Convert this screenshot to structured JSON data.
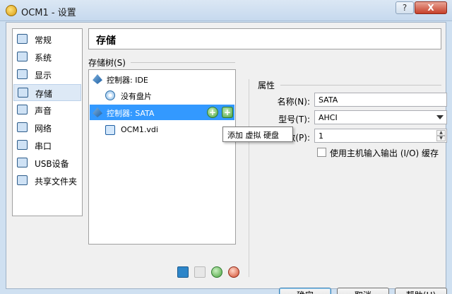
{
  "window": {
    "title": "OCM1 - 设置",
    "help_glyph": "?",
    "close_glyph": "X"
  },
  "sidebar": {
    "items": [
      {
        "label": "常规",
        "icon": "monitor-icon"
      },
      {
        "label": "系统",
        "icon": "chip-icon"
      },
      {
        "label": "显示",
        "icon": "display-icon"
      },
      {
        "label": "存储",
        "icon": "storage-icon",
        "selected": true
      },
      {
        "label": "声音",
        "icon": "speaker-icon"
      },
      {
        "label": "网络",
        "icon": "network-icon"
      },
      {
        "label": "串口",
        "icon": "serial-port-icon"
      },
      {
        "label": "USB设备",
        "icon": "usb-icon"
      },
      {
        "label": "共享文件夹",
        "icon": "folder-icon"
      }
    ]
  },
  "page_title": "存储",
  "storage_tree": {
    "label": "存储树(S)",
    "rows": [
      {
        "text": "控制器: IDE",
        "type": "controller"
      },
      {
        "text": "没有盘片",
        "type": "disc"
      },
      {
        "text": "控制器: SATA",
        "type": "controller",
        "selected": true
      },
      {
        "text": "OCM1.vdi",
        "type": "vdi"
      }
    ],
    "tooltip": "添加 虚拟 硬盘"
  },
  "properties": {
    "heading": "属性",
    "name_label": "名称(N):",
    "name_value": "SATA",
    "type_label": "型号(T):",
    "type_value": "AHCI",
    "port_label": "端口数(P):",
    "port_value": "1",
    "spin_up": "▲",
    "spin_down": "▼",
    "hostio_label": "使用主机输入输出 (I/O) 缓存",
    "hostio_checked": false
  },
  "buttons": {
    "ok": "确定",
    "cancel": "取消",
    "help": "帮助(H)"
  }
}
